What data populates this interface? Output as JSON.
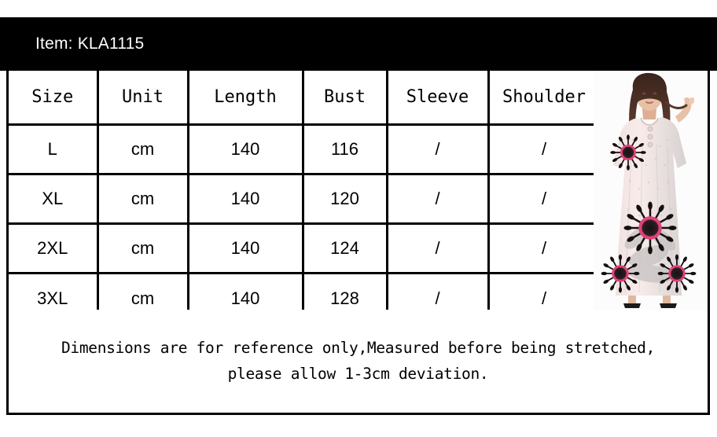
{
  "header": {
    "item_label": "Item: KLA1115"
  },
  "table": {
    "columns": [
      "Size",
      "Unit",
      "Length",
      "Bust",
      "Sleeve",
      "Shoulder"
    ],
    "rows": [
      {
        "size": "L",
        "unit": "cm",
        "length": "140",
        "bust": "116",
        "sleeve": "/",
        "shoulder": "/"
      },
      {
        "size": "XL",
        "unit": "cm",
        "length": "140",
        "bust": "120",
        "sleeve": "/",
        "shoulder": "/"
      },
      {
        "size": "2XL",
        "unit": "cm",
        "length": "140",
        "bust": "124",
        "sleeve": "/",
        "shoulder": "/"
      },
      {
        "size": "3XL",
        "unit": "cm",
        "length": "140",
        "bust": "128",
        "sleeve": "/",
        "shoulder": "/"
      }
    ]
  },
  "note": {
    "line1": "Dimensions are for reference only,Measured before being stretched,",
    "line2": "please allow 1-3cm deviation."
  },
  "photo": {
    "alt": "model-wearing-pink-floral-maxi-dress",
    "colors": {
      "fabric": "#f6e7e6",
      "fabric_shadow": "#d9d5d6",
      "flower_pink": "#e0417a",
      "flower_center": "#1b1618",
      "hair": "#4a3027",
      "skin": "#e8c0a6",
      "background": "#fdfcfc"
    }
  },
  "palette": {
    "band_bg": "#000000",
    "band_text": "#ffffff",
    "border": "#000000",
    "cell_bg": "#ffffff",
    "text": "#000000"
  }
}
